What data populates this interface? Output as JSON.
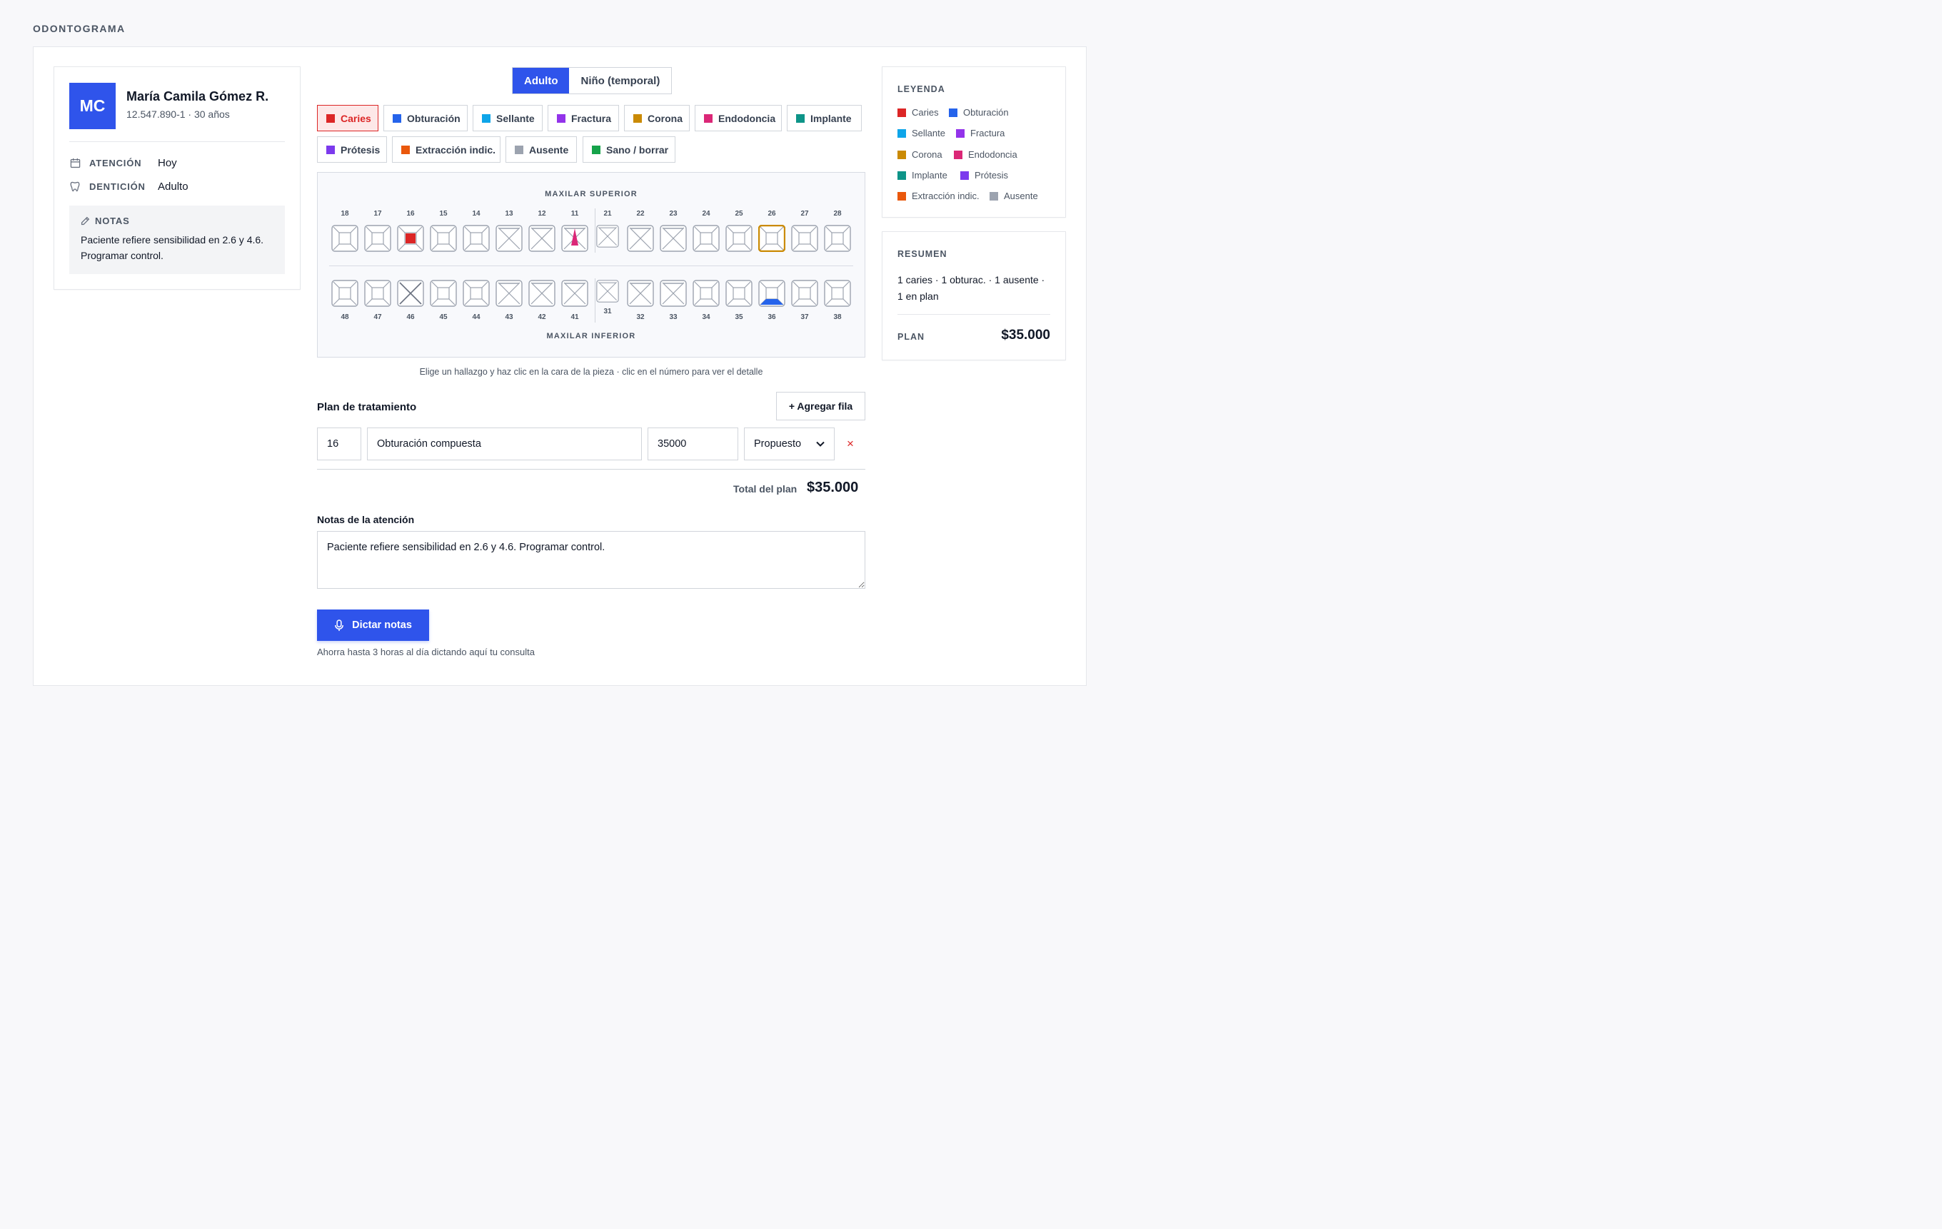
{
  "page": {
    "title": "ODONTOGRAMA"
  },
  "patient": {
    "initials": "MC",
    "name": "María Camila Gómez R.",
    "id_line": "12.547.890-1 · 30 años",
    "attention_label": "ATENCIÓN",
    "attention_value": "Hoy",
    "dentition_label": "DENTICIÓN",
    "dentition_value": "Adulto",
    "notes_title": "NOTAS",
    "notes_text": "Paciente refiere sensibilidad en 2.6 y 4.6. Programar control."
  },
  "dentition_toggle": {
    "adult": "Adulto",
    "child": "Niño (temporal)",
    "selected": "Adulto"
  },
  "tools": [
    {
      "key": "caries",
      "label": "Caries",
      "color": "#dc2626",
      "active": true
    },
    {
      "key": "obturacion",
      "label": "Obturación",
      "color": "#2563eb"
    },
    {
      "key": "sellante",
      "label": "Sellante",
      "color": "#0ea5e9"
    },
    {
      "key": "fractura",
      "label": "Fractura",
      "color": "#9333ea"
    },
    {
      "key": "corona",
      "label": "Corona",
      "color": "#ca8a04"
    },
    {
      "key": "endodoncia",
      "label": "Endodoncia",
      "color": "#db2777"
    },
    {
      "key": "implante",
      "label": "Implante",
      "color": "#0d9488"
    },
    {
      "key": "protesis",
      "label": "Prótesis",
      "color": "#7c3aed"
    },
    {
      "key": "extraccion",
      "label": "Extracción indic.",
      "color": "#ea580c"
    },
    {
      "key": "ausente",
      "label": "Ausente",
      "color": "#9ca3af"
    },
    {
      "key": "sano",
      "label": "Sano / borrar",
      "color": "#16a34a"
    }
  ],
  "chart": {
    "upper_label": "MAXILAR SUPERIOR",
    "lower_label": "MAXILAR INFERIOR",
    "upper": [
      {
        "n": "18"
      },
      {
        "n": "17"
      },
      {
        "n": "16",
        "finding": "caries"
      },
      {
        "n": "15"
      },
      {
        "n": "14"
      },
      {
        "n": "13",
        "variant": "anterior"
      },
      {
        "n": "12",
        "variant": "anterior"
      },
      {
        "n": "11",
        "variant": "anterior",
        "finding": "endodoncia"
      },
      {
        "n": "21",
        "variant": "anterior",
        "small": true
      },
      {
        "n": "22",
        "variant": "anterior"
      },
      {
        "n": "23",
        "variant": "anterior"
      },
      {
        "n": "24"
      },
      {
        "n": "25"
      },
      {
        "n": "26",
        "highlight": "corona"
      },
      {
        "n": "27"
      },
      {
        "n": "28"
      }
    ],
    "lower": [
      {
        "n": "48"
      },
      {
        "n": "47"
      },
      {
        "n": "46",
        "finding": "ausente"
      },
      {
        "n": "45"
      },
      {
        "n": "44"
      },
      {
        "n": "43",
        "variant": "anterior"
      },
      {
        "n": "42",
        "variant": "anterior"
      },
      {
        "n": "41",
        "variant": "anterior"
      },
      {
        "n": "31",
        "variant": "anterior",
        "small": true
      },
      {
        "n": "32",
        "variant": "anterior"
      },
      {
        "n": "33",
        "variant": "anterior"
      },
      {
        "n": "34"
      },
      {
        "n": "35"
      },
      {
        "n": "36",
        "finding": "obturacion"
      },
      {
        "n": "37"
      },
      {
        "n": "38"
      }
    ],
    "hint": "Elige un hallazgo y haz clic en la cara de la pieza · clic en el número para ver el detalle"
  },
  "plan": {
    "title": "Plan de tratamiento",
    "add_row_label": "+ Agregar fila",
    "rows": [
      {
        "tooth": "16",
        "procedure": "Obturación compuesta",
        "price": "35000",
        "status": "Propuesto"
      }
    ],
    "status_options": [
      "Propuesto"
    ],
    "remove_label": "×",
    "total_label": "Total del plan",
    "total_value": "$35.000"
  },
  "visit_notes": {
    "label": "Notas de la atención",
    "value": "Paciente refiere sensibilidad en 2.6 y 4.6. Programar control."
  },
  "dictation": {
    "button_label": "Dictar notas",
    "hint": "Ahorra hasta 3 horas al día dictando aquí tu consulta"
  },
  "legend": {
    "title": "LEYENDA",
    "items": [
      {
        "label": "Caries",
        "color": "#dc2626"
      },
      {
        "label": "Obturación",
        "color": "#2563eb"
      },
      {
        "label": "Sellante",
        "color": "#0ea5e9"
      },
      {
        "label": "Fractura",
        "color": "#9333ea"
      },
      {
        "label": "Corona",
        "color": "#ca8a04"
      },
      {
        "label": "Endodoncia",
        "color": "#db2777"
      },
      {
        "label": "Implante",
        "color": "#0d9488"
      },
      {
        "label": "Prótesis",
        "color": "#7c3aed"
      },
      {
        "label": "Extracción indic.",
        "color": "#ea580c"
      },
      {
        "label": "Ausente",
        "color": "#9ca3af"
      }
    ]
  },
  "summary": {
    "title": "RESUMEN",
    "text": "1 caries · 1 obturac. · 1 ausente · 1 en plan",
    "plan_label": "PLAN",
    "plan_value": "$35.000"
  }
}
